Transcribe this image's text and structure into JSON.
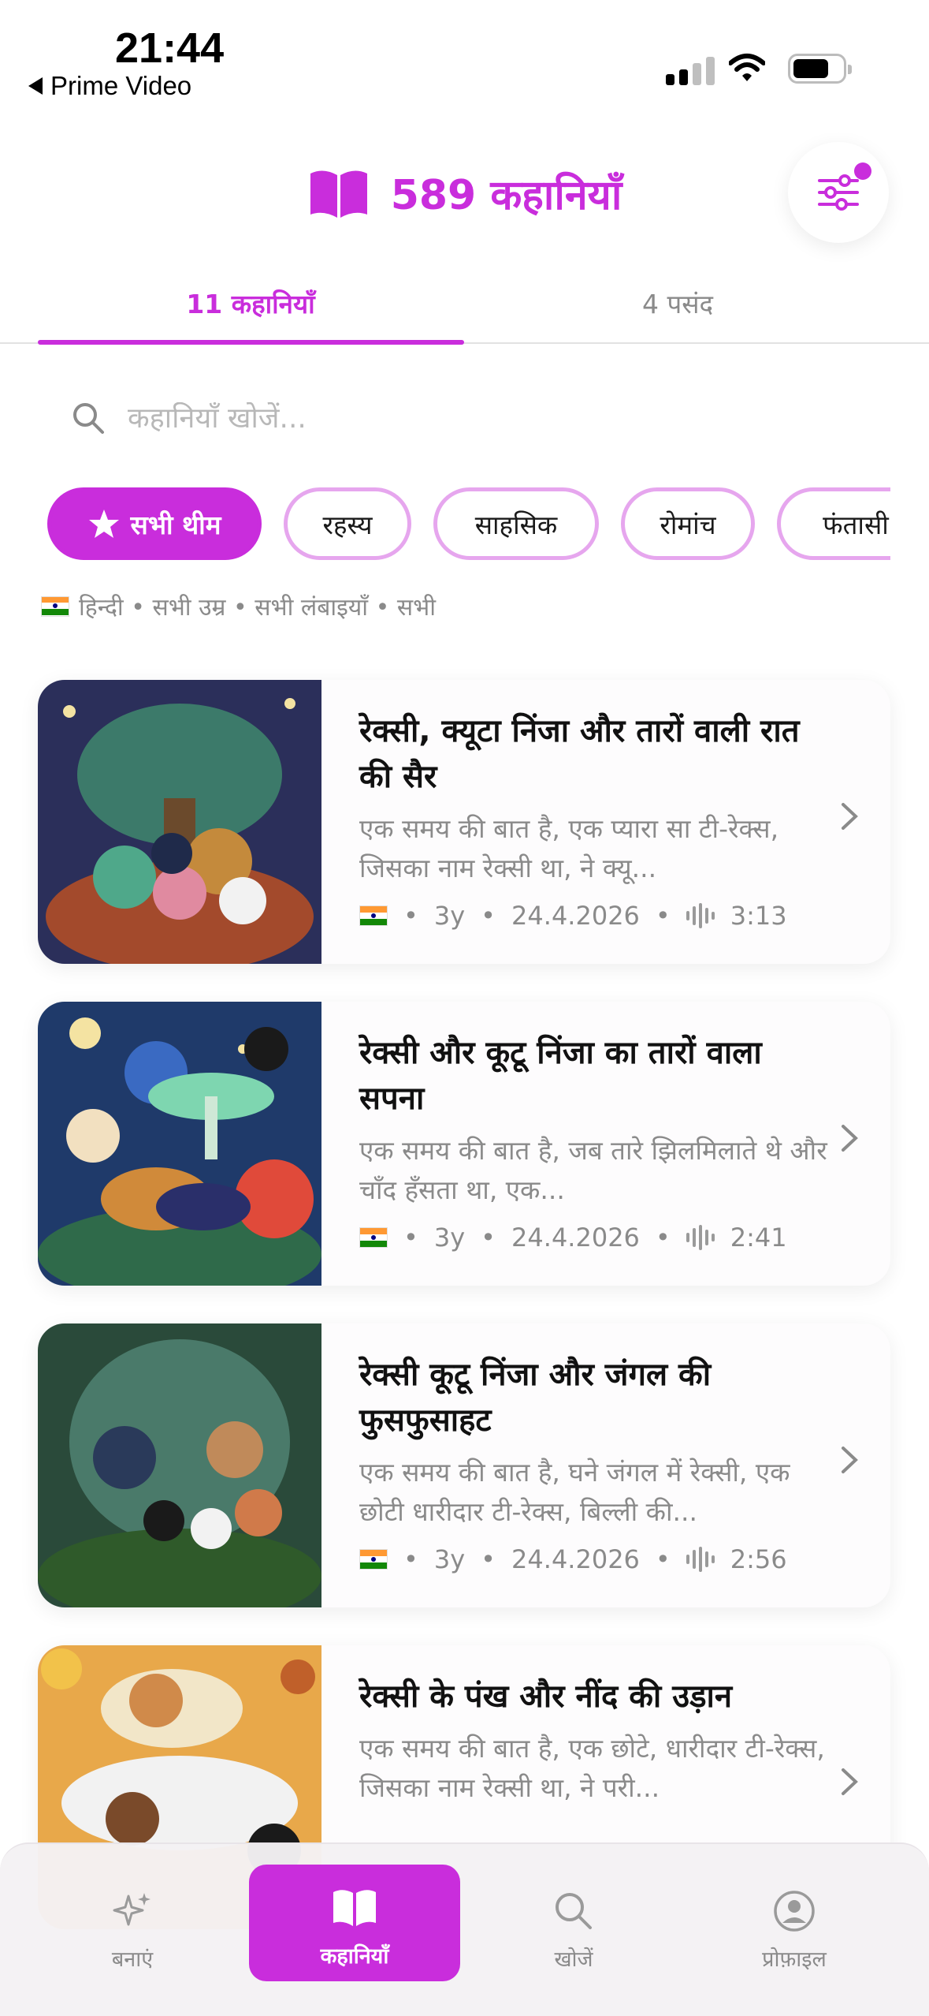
{
  "status_bar": {
    "time": "21:44",
    "back_label": "Prime Video"
  },
  "header": {
    "count_title": "589 कहानियाँ",
    "icon": "book-icon",
    "filter_icon": "sliders-icon"
  },
  "tabs": [
    {
      "label": "11 कहानियाँ",
      "active": true
    },
    {
      "label": "4 पसंद",
      "active": false
    }
  ],
  "search": {
    "placeholder": "कहानियाँ खोजें..."
  },
  "chips": [
    {
      "label": "सभी थीम",
      "active": true,
      "icon": "star-icon"
    },
    {
      "label": "रहस्य"
    },
    {
      "label": "साहसिक"
    },
    {
      "label": "रोमांच"
    },
    {
      "label": "फंतासी"
    }
  ],
  "filter_summary": "हिन्दी • सभी उम्र • सभी लंबाइयाँ • सभी",
  "stories": [
    {
      "title": "रेक्सी, क्यूटा निंजा और तारों वाली रात की सैर",
      "excerpt": "एक समय की बात है, एक प्यारा सा टी-रेक्स, जिसका नाम रेक्सी था, ने क्यू...",
      "age": "3y",
      "date": "24.4.2026",
      "duration": "3:13"
    },
    {
      "title": "रेक्सी और कूटू निंजा का तारों वाला सपना",
      "excerpt": "एक समय की बात है, जब तारे झिलमिलाते थे और चाँद हँसता था, एक...",
      "age": "3y",
      "date": "24.4.2026",
      "duration": "2:41"
    },
    {
      "title": "रेक्सी कूटू निंजा और जंगल की फुसफुसाहट",
      "excerpt": "एक समय की बात है, घने जंगल में रेक्सी, एक छोटी धारीदार टी-रेक्स, बिल्ली की...",
      "age": "3y",
      "date": "24.4.2026",
      "duration": "2:56"
    },
    {
      "title": "रेक्सी के पंख और नींद की उड़ान",
      "excerpt": "एक समय की बात है, एक छोटे, धारीदार टी-रेक्स, जिसका नाम रेक्सी था, ने परी...",
      "age": "",
      "date": "",
      "duration": ""
    }
  ],
  "meta_separator": "•",
  "bottom_nav": [
    {
      "label": "बनाएं",
      "icon": "sparkle-icon"
    },
    {
      "label": "कहानियाँ",
      "icon": "book-icon",
      "active": true
    },
    {
      "label": "खोजें",
      "icon": "search-icon"
    },
    {
      "label": "प्रोफ़ाइल",
      "icon": "profile-icon"
    }
  ],
  "colors": {
    "accent": "#c92ddc",
    "chip_border": "#e6a6ee",
    "muted_text": "#8a8a8a"
  }
}
